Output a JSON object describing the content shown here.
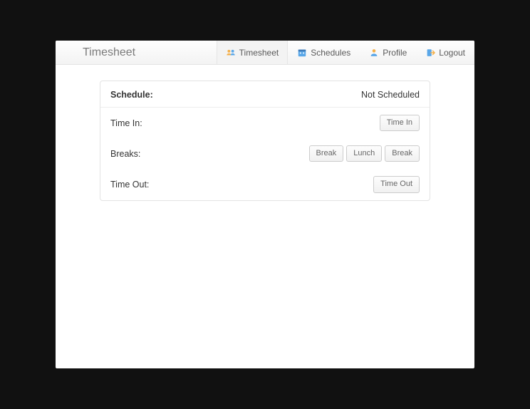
{
  "brand": "Timesheet",
  "nav": {
    "timesheet": "Timesheet",
    "schedules": "Schedules",
    "profile": "Profile",
    "logout": "Logout"
  },
  "schedule": {
    "label": "Schedule:",
    "value": "Not Scheduled"
  },
  "rows": {
    "time_in": {
      "label": "Time In:"
    },
    "breaks": {
      "label": "Breaks:"
    },
    "time_out": {
      "label": "Time Out:"
    }
  },
  "buttons": {
    "time_in": "Time In",
    "break1": "Break",
    "lunch": "Lunch",
    "break2": "Break",
    "time_out": "Time Out"
  }
}
